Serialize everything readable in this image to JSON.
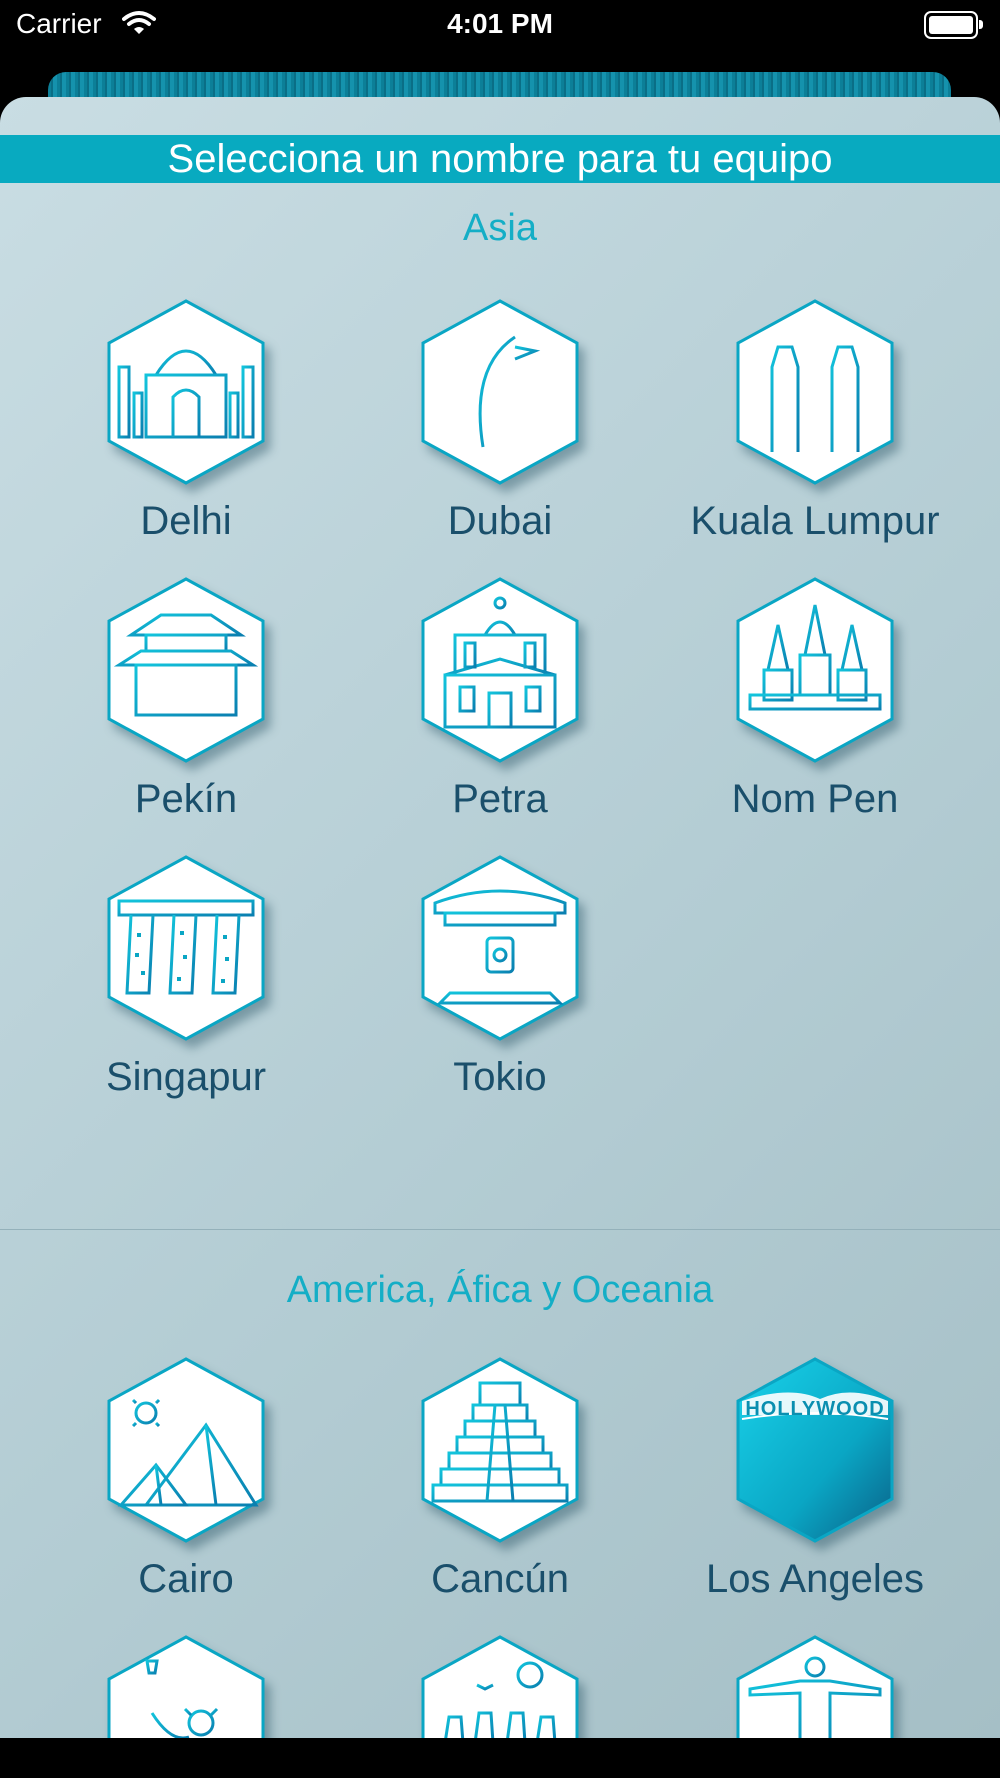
{
  "status": {
    "carrier": "Carrier",
    "time": "4:01 PM"
  },
  "header": {
    "title": "Selecciona un nombre para tu equipo"
  },
  "sections": [
    {
      "title": "Asia",
      "items": [
        {
          "label": "Delhi",
          "icon": "taj-mahal-icon"
        },
        {
          "label": "Dubai",
          "icon": "burj-al-arab-icon"
        },
        {
          "label": "Kuala Lumpur",
          "icon": "petronas-towers-icon"
        },
        {
          "label": "Pekín",
          "icon": "forbidden-city-icon"
        },
        {
          "label": "Petra",
          "icon": "petra-treasury-icon"
        },
        {
          "label": "Nom Pen",
          "icon": "angkor-temple-icon"
        },
        {
          "label": "Singapur",
          "icon": "marina-bay-sands-icon"
        },
        {
          "label": "Tokio",
          "icon": "japanese-gate-icon"
        }
      ]
    },
    {
      "title": "America, Áfica y Oceania",
      "items": [
        {
          "label": "Cairo",
          "icon": "pyramids-icon"
        },
        {
          "label": "Cancún",
          "icon": "chichen-itza-icon"
        },
        {
          "label": "Los Angeles",
          "icon": "hollywood-sign-icon",
          "badge_text": "HOLLYWOOD"
        },
        {
          "label": "",
          "icon": "statue-of-liberty-icon"
        },
        {
          "label": "",
          "icon": "easter-island-icon"
        },
        {
          "label": "",
          "icon": "christ-redeemer-icon"
        }
      ]
    }
  ],
  "colors": {
    "accent": "#08aac0",
    "label": "#1a4f6b",
    "icon": "#0aa6c4"
  }
}
